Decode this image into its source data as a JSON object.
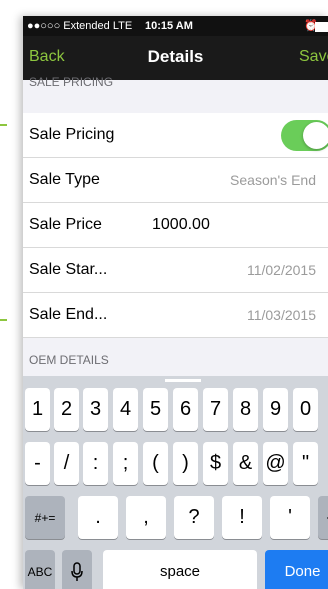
{
  "status_bar": {
    "carrier": "●●○○○ Extended  LTE",
    "time": "10:15 AM",
    "alarm_icon": "alarm-clock-icon",
    "battery_icon": "battery-icon"
  },
  "nav": {
    "back": "Back",
    "title": "Details",
    "save": "Save"
  },
  "sections": {
    "sale_pricing_header": "SALE PRICING",
    "oem_header": "OEM DETAILS"
  },
  "rows": {
    "sale_pricing": {
      "label": "Sale Pricing",
      "toggle_on": true,
      "toggle_color": "#6acd59"
    },
    "sale_type": {
      "label": "Sale Type",
      "value": "Season's End"
    },
    "sale_price": {
      "label": "Sale Price",
      "value": "1000.00"
    },
    "sale_start": {
      "label": "Sale Star...",
      "value": "11/02/2015"
    },
    "sale_end": {
      "label": "Sale End...",
      "value": "11/03/2015"
    }
  },
  "keyboard": {
    "row1": [
      "1",
      "2",
      "3",
      "4",
      "5",
      "6",
      "7",
      "8",
      "9",
      "0"
    ],
    "row2": [
      "-",
      "/",
      ":",
      ";",
      "(",
      ")",
      "$",
      "&",
      "@",
      "\""
    ],
    "row3": {
      "shift": "#+=",
      "keys": [
        ".",
        ",",
        "?",
        "!",
        "'"
      ],
      "backspace_icon": "backspace-icon"
    },
    "row4": {
      "abc": "ABC",
      "mic_icon": "microphone-icon",
      "space": "space",
      "done": "Done"
    }
  },
  "colors": {
    "accent": "#8dc63f",
    "navbar": "#1a1a1a",
    "done_key": "#1d7cf2"
  }
}
